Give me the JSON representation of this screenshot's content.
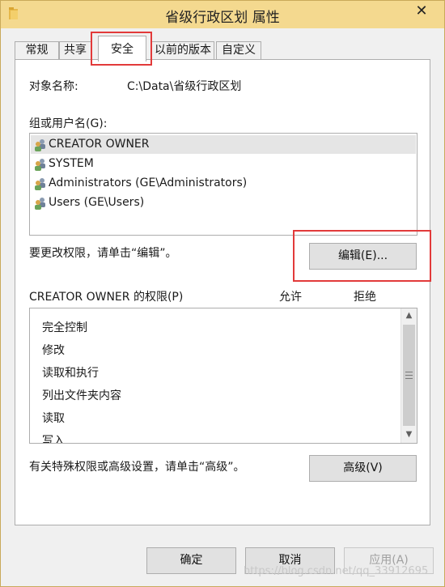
{
  "window": {
    "title": "省级行政区划 属性",
    "close_glyph": "✕"
  },
  "tabs": [
    {
      "label": "常规"
    },
    {
      "label": "共享"
    },
    {
      "label": "安全",
      "active": true
    },
    {
      "label": "以前的版本"
    },
    {
      "label": "自定义"
    }
  ],
  "security": {
    "object_name_label": "对象名称:",
    "object_name_value": "C:\\Data\\省级行政区划",
    "group_label": "组或用户名(G):",
    "users": [
      {
        "name": "CREATOR OWNER",
        "selected": true
      },
      {
        "name": "SYSTEM"
      },
      {
        "name": "Administrators (GE\\Administrators)"
      },
      {
        "name": "Users (GE\\Users)"
      }
    ],
    "change_hint": "要更改权限，请单击“编辑”。",
    "edit_button": "编辑(E)...",
    "permissions_label": "CREATOR OWNER 的权限(P)",
    "allow_header": "允许",
    "deny_header": "拒绝",
    "permissions": [
      "完全控制",
      "修改",
      "读取和执行",
      "列出文件夹内容",
      "读取",
      "写入"
    ],
    "advanced_hint": "有关特殊权限或高级设置，请单击“高级”。",
    "advanced_button": "高级(V)"
  },
  "footer": {
    "ok_button": "确定",
    "cancel_button": "取消",
    "apply_button": "应用(A)"
  },
  "watermark": "https://blog.csdn.net/qq_33912695",
  "colors": {
    "titlebar": "#f4d98f",
    "highlight_box": "#e23a3a"
  }
}
